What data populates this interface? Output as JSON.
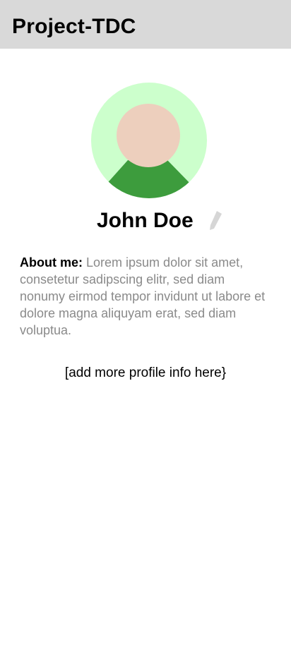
{
  "header": {
    "title": "Project-TDC"
  },
  "profile": {
    "avatar_icon": "user-avatar-icon",
    "name": "John Doe",
    "edit_icon": "pencil-icon",
    "about_label": "About me:",
    "about_text": "Lorem ipsum dolor sit amet, consetetur sadipscing elitr, sed diam nonumy eirmod tempor invidunt ut labore et dolore magna aliquyam erat, sed diam voluptua.",
    "more_info": "[add more profile info here}"
  },
  "colors": {
    "header_bg": "#d9d9d9",
    "avatar_bg": "#ccffcc",
    "avatar_face": "#edcfbd",
    "avatar_body": "#3d9c3d",
    "muted_text": "#8a8a8a",
    "edit_icon": "#d6d6d6"
  }
}
